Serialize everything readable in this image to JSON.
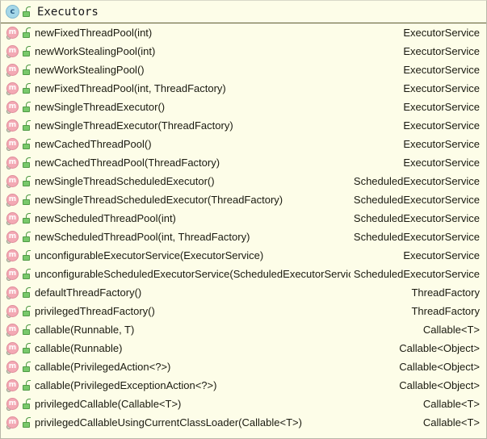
{
  "popup": {
    "kind": "java-structure-popup",
    "background_color": "#fdfde8",
    "border_color": "#b8b8a8",
    "separator_color": "#5c5a33",
    "text_color": "#1a1a10",
    "class_icon_color": "#a5d7e8",
    "method_icon_color": "#f3a9b4",
    "lock_icon_color": "#79c96b"
  },
  "header": {
    "title": "Executors",
    "class_icon_glyph": "c",
    "visibility_icon": "public-unlocked-icon"
  },
  "members": [
    {
      "icon": "m",
      "signature": "newFixedThreadPool(int)",
      "return_type": "ExecutorService"
    },
    {
      "icon": "m",
      "signature": "newWorkStealingPool(int)",
      "return_type": "ExecutorService"
    },
    {
      "icon": "m",
      "signature": "newWorkStealingPool()",
      "return_type": "ExecutorService"
    },
    {
      "icon": "m",
      "signature": "newFixedThreadPool(int, ThreadFactory)",
      "return_type": "ExecutorService"
    },
    {
      "icon": "m",
      "signature": "newSingleThreadExecutor()",
      "return_type": "ExecutorService"
    },
    {
      "icon": "m",
      "signature": "newSingleThreadExecutor(ThreadFactory)",
      "return_type": "ExecutorService"
    },
    {
      "icon": "m",
      "signature": "newCachedThreadPool()",
      "return_type": "ExecutorService"
    },
    {
      "icon": "m",
      "signature": "newCachedThreadPool(ThreadFactory)",
      "return_type": "ExecutorService"
    },
    {
      "icon": "m",
      "signature": "newSingleThreadScheduledExecutor()",
      "return_type": "ScheduledExecutorService"
    },
    {
      "icon": "m",
      "signature": "newSingleThreadScheduledExecutor(ThreadFactory)",
      "return_type": "ScheduledExecutorService"
    },
    {
      "icon": "m",
      "signature": "newScheduledThreadPool(int)",
      "return_type": "ScheduledExecutorService"
    },
    {
      "icon": "m",
      "signature": "newScheduledThreadPool(int, ThreadFactory)",
      "return_type": "ScheduledExecutorService"
    },
    {
      "icon": "m",
      "signature": "unconfigurableExecutorService(ExecutorService)",
      "return_type": "ExecutorService"
    },
    {
      "icon": "m",
      "signature": "unconfigurableScheduledExecutorService(ScheduledExecutorService)",
      "return_type": "ScheduledExecutorService"
    },
    {
      "icon": "m",
      "signature": "defaultThreadFactory()",
      "return_type": "ThreadFactory"
    },
    {
      "icon": "m",
      "signature": "privilegedThreadFactory()",
      "return_type": "ThreadFactory"
    },
    {
      "icon": "m",
      "signature": "callable(Runnable, T)",
      "return_type": "Callable<T>"
    },
    {
      "icon": "m",
      "signature": "callable(Runnable)",
      "return_type": "Callable<Object>"
    },
    {
      "icon": "m",
      "signature": "callable(PrivilegedAction<?>)",
      "return_type": "Callable<Object>"
    },
    {
      "icon": "m",
      "signature": "callable(PrivilegedExceptionAction<?>)",
      "return_type": "Callable<Object>"
    },
    {
      "icon": "m",
      "signature": "privilegedCallable(Callable<T>)",
      "return_type": "Callable<T>"
    },
    {
      "icon": "m",
      "signature": "privilegedCallableUsingCurrentClassLoader(Callable<T>)",
      "return_type": "Callable<T>"
    }
  ]
}
